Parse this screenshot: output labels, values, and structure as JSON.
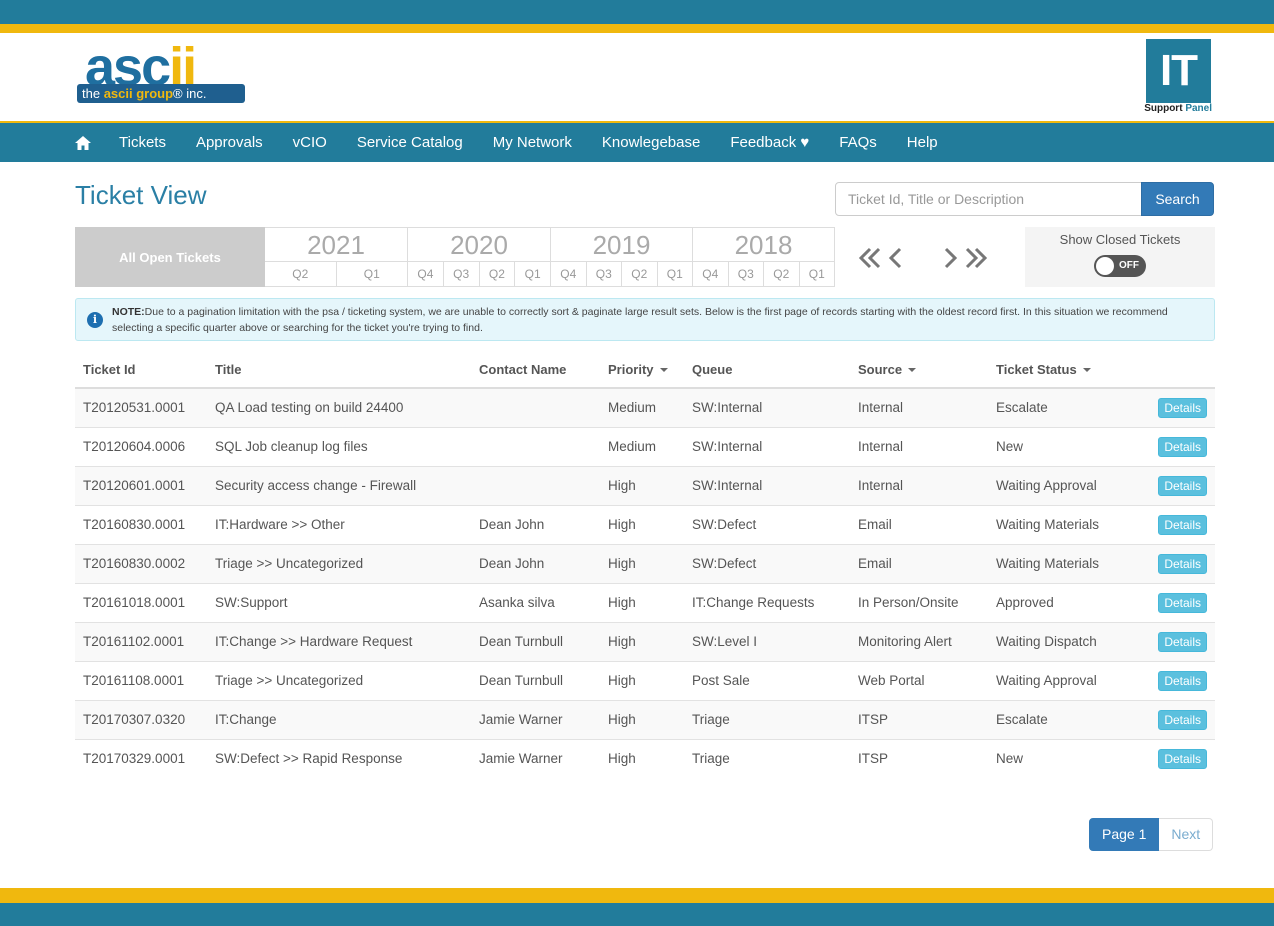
{
  "brand": {
    "logo_word_a": "asc",
    "logo_word_b": "ii",
    "logo_strip_pre": "the ",
    "logo_strip_mid": "ascii group",
    "logo_strip_post": "® inc.",
    "it_box": "IT",
    "it_caption_a": "Support ",
    "it_caption_b": "Panel",
    "colors": {
      "teal": "#227c9b",
      "gold": "#f0b80e",
      "primary": "#337ab7",
      "info": "#5bc0de"
    }
  },
  "nav": {
    "home_icon": "home-icon",
    "items": [
      "Tickets",
      "Approvals",
      "vCIO",
      "Service Catalog",
      "My Network",
      "Knowlegebase",
      "Feedback ♥",
      "FAQs",
      "Help"
    ]
  },
  "page": {
    "title": "Ticket View"
  },
  "search": {
    "placeholder": "Ticket Id, Title or Description",
    "button": "Search"
  },
  "filters": {
    "all_open": "All Open Tickets",
    "years": [
      {
        "year": "2021",
        "quarters": [
          "Q2",
          "Q1"
        ]
      },
      {
        "year": "2020",
        "quarters": [
          "Q4",
          "Q3",
          "Q2",
          "Q1"
        ]
      },
      {
        "year": "2019",
        "quarters": [
          "Q4",
          "Q3",
          "Q2",
          "Q1"
        ]
      },
      {
        "year": "2018",
        "quarters": [
          "Q4",
          "Q3",
          "Q2",
          "Q1"
        ]
      }
    ],
    "show_closed_label": "Show Closed Tickets",
    "toggle_state": "OFF"
  },
  "note": {
    "lead": "NOTE:",
    "text": "Due to a pagination limitation with the psa / ticketing system, we are unable to correctly sort & paginate large result sets. Below is the first page of records starting with the oldest record first. In this situation we recommend selecting a specific quarter above or searching for the ticket you're trying to find."
  },
  "table": {
    "columns": [
      "Ticket Id",
      "Title",
      "Contact Name",
      "Priority",
      "Queue",
      "Source",
      "Ticket Status"
    ],
    "details_label": "Details",
    "rows": [
      [
        "T20120531.0001",
        "QA Load testing on build 24400",
        "",
        "Medium",
        "SW:Internal",
        "Internal",
        "Escalate"
      ],
      [
        "T20120604.0006",
        "SQL Job cleanup log files",
        "",
        "Medium",
        "SW:Internal",
        "Internal",
        "New"
      ],
      [
        "T20120601.0001",
        "Security access change - Firewall",
        "",
        "High",
        "SW:Internal",
        "Internal",
        "Waiting Approval"
      ],
      [
        "T20160830.0001",
        "IT:Hardware >> Other",
        "Dean John",
        "High",
        "SW:Defect",
        "Email",
        "Waiting Materials"
      ],
      [
        "T20160830.0002",
        "Triage >> Uncategorized",
        "Dean John",
        "High",
        "SW:Defect",
        "Email",
        "Waiting Materials"
      ],
      [
        "T20161018.0001",
        "SW:Support",
        "Asanka silva",
        "High",
        "IT:Change Requests",
        "In Person/Onsite",
        "Approved"
      ],
      [
        "T20161102.0001",
        "IT:Change >> Hardware Request",
        "Dean Turnbull",
        "High",
        "SW:Level I",
        "Monitoring Alert",
        "Waiting Dispatch"
      ],
      [
        "T20161108.0001",
        "Triage >> Uncategorized",
        "Dean Turnbull",
        "High",
        "Post Sale",
        "Web Portal",
        "Waiting Approval"
      ],
      [
        "T20170307.0320",
        "IT:Change",
        "Jamie Warner",
        "High",
        "Triage",
        "ITSP",
        "Escalate"
      ],
      [
        "T20170329.0001",
        "SW:Defect >> Rapid Response",
        "Jamie Warner",
        "High",
        "Triage",
        "ITSP",
        "New"
      ]
    ]
  },
  "pagination": {
    "current": "Page 1",
    "next": "Next"
  }
}
